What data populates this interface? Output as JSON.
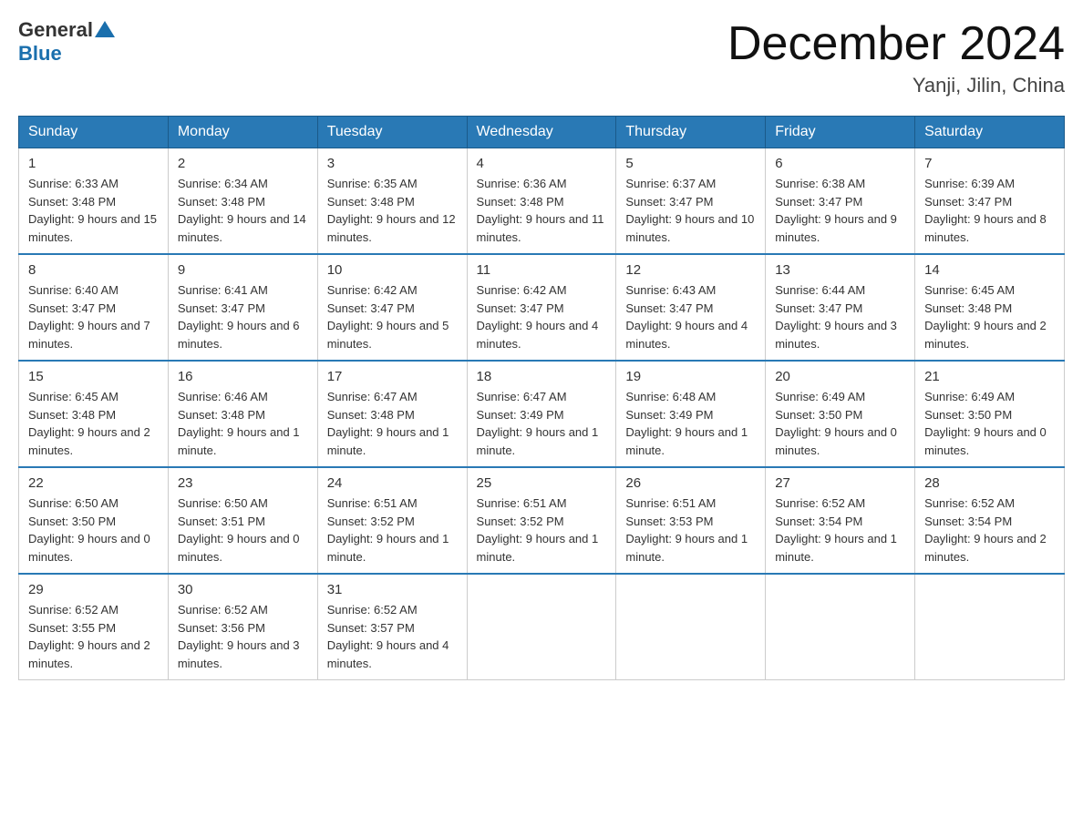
{
  "header": {
    "logo": {
      "general": "General",
      "blue": "Blue"
    },
    "title": "December 2024",
    "location": "Yanji, Jilin, China"
  },
  "columns": [
    "Sunday",
    "Monday",
    "Tuesday",
    "Wednesday",
    "Thursday",
    "Friday",
    "Saturday"
  ],
  "weeks": [
    [
      {
        "day": "1",
        "sunrise": "6:33 AM",
        "sunset": "3:48 PM",
        "daylight": "9 hours and 15 minutes."
      },
      {
        "day": "2",
        "sunrise": "6:34 AM",
        "sunset": "3:48 PM",
        "daylight": "9 hours and 14 minutes."
      },
      {
        "day": "3",
        "sunrise": "6:35 AM",
        "sunset": "3:48 PM",
        "daylight": "9 hours and 12 minutes."
      },
      {
        "day": "4",
        "sunrise": "6:36 AM",
        "sunset": "3:48 PM",
        "daylight": "9 hours and 11 minutes."
      },
      {
        "day": "5",
        "sunrise": "6:37 AM",
        "sunset": "3:47 PM",
        "daylight": "9 hours and 10 minutes."
      },
      {
        "day": "6",
        "sunrise": "6:38 AM",
        "sunset": "3:47 PM",
        "daylight": "9 hours and 9 minutes."
      },
      {
        "day": "7",
        "sunrise": "6:39 AM",
        "sunset": "3:47 PM",
        "daylight": "9 hours and 8 minutes."
      }
    ],
    [
      {
        "day": "8",
        "sunrise": "6:40 AM",
        "sunset": "3:47 PM",
        "daylight": "9 hours and 7 minutes."
      },
      {
        "day": "9",
        "sunrise": "6:41 AM",
        "sunset": "3:47 PM",
        "daylight": "9 hours and 6 minutes."
      },
      {
        "day": "10",
        "sunrise": "6:42 AM",
        "sunset": "3:47 PM",
        "daylight": "9 hours and 5 minutes."
      },
      {
        "day": "11",
        "sunrise": "6:42 AM",
        "sunset": "3:47 PM",
        "daylight": "9 hours and 4 minutes."
      },
      {
        "day": "12",
        "sunrise": "6:43 AM",
        "sunset": "3:47 PM",
        "daylight": "9 hours and 4 minutes."
      },
      {
        "day": "13",
        "sunrise": "6:44 AM",
        "sunset": "3:47 PM",
        "daylight": "9 hours and 3 minutes."
      },
      {
        "day": "14",
        "sunrise": "6:45 AM",
        "sunset": "3:48 PM",
        "daylight": "9 hours and 2 minutes."
      }
    ],
    [
      {
        "day": "15",
        "sunrise": "6:45 AM",
        "sunset": "3:48 PM",
        "daylight": "9 hours and 2 minutes."
      },
      {
        "day": "16",
        "sunrise": "6:46 AM",
        "sunset": "3:48 PM",
        "daylight": "9 hours and 1 minute."
      },
      {
        "day": "17",
        "sunrise": "6:47 AM",
        "sunset": "3:48 PM",
        "daylight": "9 hours and 1 minute."
      },
      {
        "day": "18",
        "sunrise": "6:47 AM",
        "sunset": "3:49 PM",
        "daylight": "9 hours and 1 minute."
      },
      {
        "day": "19",
        "sunrise": "6:48 AM",
        "sunset": "3:49 PM",
        "daylight": "9 hours and 1 minute."
      },
      {
        "day": "20",
        "sunrise": "6:49 AM",
        "sunset": "3:50 PM",
        "daylight": "9 hours and 0 minutes."
      },
      {
        "day": "21",
        "sunrise": "6:49 AM",
        "sunset": "3:50 PM",
        "daylight": "9 hours and 0 minutes."
      }
    ],
    [
      {
        "day": "22",
        "sunrise": "6:50 AM",
        "sunset": "3:50 PM",
        "daylight": "9 hours and 0 minutes."
      },
      {
        "day": "23",
        "sunrise": "6:50 AM",
        "sunset": "3:51 PM",
        "daylight": "9 hours and 0 minutes."
      },
      {
        "day": "24",
        "sunrise": "6:51 AM",
        "sunset": "3:52 PM",
        "daylight": "9 hours and 1 minute."
      },
      {
        "day": "25",
        "sunrise": "6:51 AM",
        "sunset": "3:52 PM",
        "daylight": "9 hours and 1 minute."
      },
      {
        "day": "26",
        "sunrise": "6:51 AM",
        "sunset": "3:53 PM",
        "daylight": "9 hours and 1 minute."
      },
      {
        "day": "27",
        "sunrise": "6:52 AM",
        "sunset": "3:54 PM",
        "daylight": "9 hours and 1 minute."
      },
      {
        "day": "28",
        "sunrise": "6:52 AM",
        "sunset": "3:54 PM",
        "daylight": "9 hours and 2 minutes."
      }
    ],
    [
      {
        "day": "29",
        "sunrise": "6:52 AM",
        "sunset": "3:55 PM",
        "daylight": "9 hours and 2 minutes."
      },
      {
        "day": "30",
        "sunrise": "6:52 AM",
        "sunset": "3:56 PM",
        "daylight": "9 hours and 3 minutes."
      },
      {
        "day": "31",
        "sunrise": "6:52 AM",
        "sunset": "3:57 PM",
        "daylight": "9 hours and 4 minutes."
      },
      {
        "day": "",
        "sunrise": "",
        "sunset": "",
        "daylight": ""
      },
      {
        "day": "",
        "sunrise": "",
        "sunset": "",
        "daylight": ""
      },
      {
        "day": "",
        "sunrise": "",
        "sunset": "",
        "daylight": ""
      },
      {
        "day": "",
        "sunrise": "",
        "sunset": "",
        "daylight": ""
      }
    ]
  ]
}
